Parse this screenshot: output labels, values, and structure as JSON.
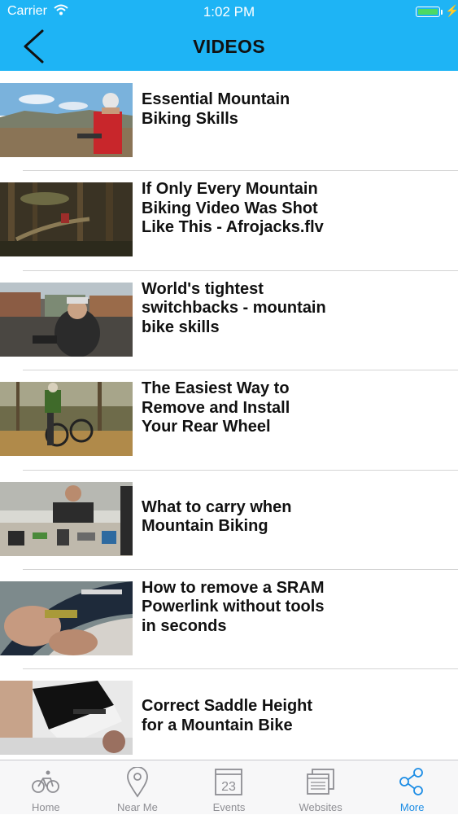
{
  "status_bar": {
    "carrier": "Carrier",
    "time": "1:02 PM"
  },
  "header": {
    "title": "VIDEOS",
    "back_icon": "chevron-left-icon"
  },
  "videos": [
    {
      "title": "Essential Mountain Biking Skills",
      "line1": "Essential Mountain",
      "line2": "Biking Skills",
      "line3": ""
    },
    {
      "title": "If Only Every Mountain Biking Video Was Shot Like This - Afrojacks.flv",
      "line1": "If Only Every Mountain",
      "line2": "Biking Video Was Shot",
      "line3": "Like This - Afrojacks.flv"
    },
    {
      "title": "World's tightest switchbacks - mountain bike skills",
      "line1": "World's tightest",
      "line2": "switchbacks - mountain",
      "line3": "bike skills"
    },
    {
      "title": "The Easiest Way to Remove and Install Your Rear Wheel",
      "line1": "The Easiest Way to",
      "line2": "Remove and Install",
      "line3": "Your Rear Wheel"
    },
    {
      "title": "What to carry when Mountain Biking",
      "line1": "What to carry when",
      "line2": "Mountain Biking",
      "line3": ""
    },
    {
      "title": "How to remove a SRAM Powerlink without tools in seconds",
      "line1": "How to remove a SRAM",
      "line2": "Powerlink without tools",
      "line3": "in seconds"
    },
    {
      "title": "Correct Saddle Height for a Mountain Bike",
      "line1": "Correct Saddle Height",
      "line2": "for a Mountain Bike",
      "line3": ""
    }
  ],
  "tabs": [
    {
      "label": "Home",
      "icon": "bicycle-icon"
    },
    {
      "label": "Near Me",
      "icon": "map-pin-icon"
    },
    {
      "label": "Events",
      "icon": "calendar-icon",
      "calendar_day": "23"
    },
    {
      "label": "Websites",
      "icon": "browser-windows-icon"
    },
    {
      "label": "More",
      "icon": "share-icon",
      "active": true
    }
  ],
  "colors": {
    "header_bg": "#1eb4f5",
    "active_tab": "#1d8de5",
    "inactive_tab": "#8e8e93"
  }
}
